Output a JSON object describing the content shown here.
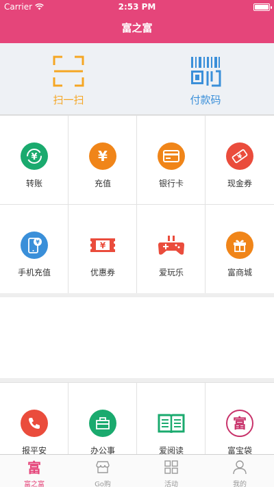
{
  "status": {
    "carrier": "Carrier",
    "time": "2:53 PM"
  },
  "nav": {
    "title": "富之富"
  },
  "quick_actions": {
    "scan_label": "扫一扫",
    "paycode_label": "付款码"
  },
  "grid": [
    {
      "label": "转账",
      "icon": "transfer-icon",
      "color": "#1aaa6e",
      "glyph": "¥"
    },
    {
      "label": "充值",
      "icon": "recharge-icon",
      "color": "#f08519",
      "glyph": "¥"
    },
    {
      "label": "银行卡",
      "icon": "bank-card-icon",
      "color": "#f08519",
      "glyph": ""
    },
    {
      "label": "现金券",
      "icon": "cash-coupon-icon",
      "color": "#ea4c3c",
      "glyph": "¥"
    },
    {
      "label": "手机充值",
      "icon": "phone-recharge-icon",
      "color": "#3a8fd9",
      "glyph": ""
    },
    {
      "label": "优惠券",
      "icon": "coupon-icon",
      "color": "#ea4c3c",
      "glyph": "¥"
    },
    {
      "label": "爱玩乐",
      "icon": "gamepad-icon",
      "color": "#ea4c3c",
      "glyph": ""
    },
    {
      "label": "富商城",
      "icon": "gift-icon",
      "color": "#f08519",
      "glyph": ""
    }
  ],
  "services": [
    {
      "label": "报平安",
      "icon": "phone-call-icon",
      "color": "#ea4c3c"
    },
    {
      "label": "办公事",
      "icon": "briefcase-icon",
      "color": "#1aaa6e"
    },
    {
      "label": "爱阅读",
      "icon": "book-icon",
      "color": "#1aaa6e"
    },
    {
      "label": "富宝袋",
      "icon": "fu-bag-icon",
      "color": "#c8326a"
    }
  ],
  "tabs": [
    {
      "label": "富之富",
      "icon": "fu-logo-icon",
      "active": true
    },
    {
      "label": "Go购",
      "icon": "shop-icon",
      "active": false
    },
    {
      "label": "活动",
      "icon": "grid-icon",
      "active": false
    },
    {
      "label": "我的",
      "icon": "user-icon",
      "active": false
    }
  ],
  "colors": {
    "brand": "#e5457a",
    "scan": "#f5a623",
    "paycode": "#3a8fd9"
  }
}
